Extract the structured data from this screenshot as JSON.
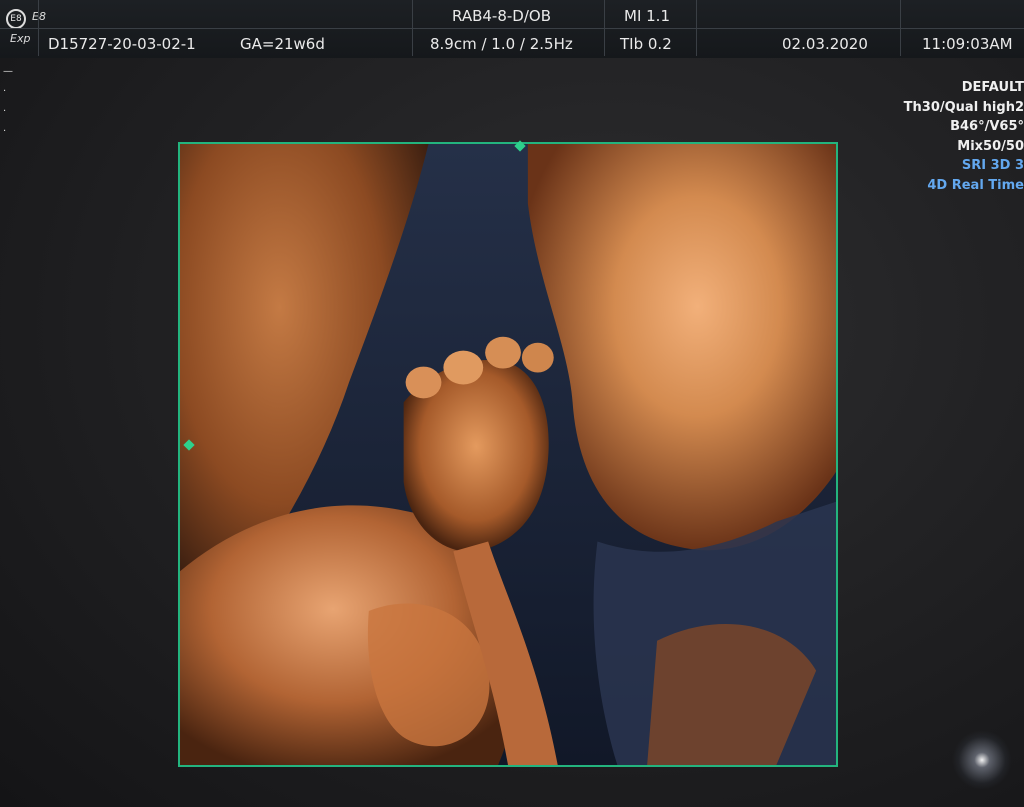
{
  "header": {
    "logo": "E8",
    "mode": "Exp",
    "probe": "RAB4-8-D/OB",
    "mi": "MI  1.1",
    "patient_id": "D15727-20-03-02-1",
    "ga": "GA=21w6d",
    "depth_freq": "8.9cm / 1.0 / 2.5Hz",
    "tib": "TIb  0.2",
    "date": "02.03.2020",
    "time": "11:09:03AM"
  },
  "right_panel": {
    "preset": "DEFAULT",
    "threshold": "Th30/Qual high2",
    "angles": "B46°/V65°",
    "mix": "Mix50/50",
    "sri": "SRI 3D 3",
    "mode": "4D Real Time"
  },
  "colors": {
    "frame": "#23b47e",
    "accent_blue": "#63a8ef",
    "tissue": "#c9763e"
  }
}
